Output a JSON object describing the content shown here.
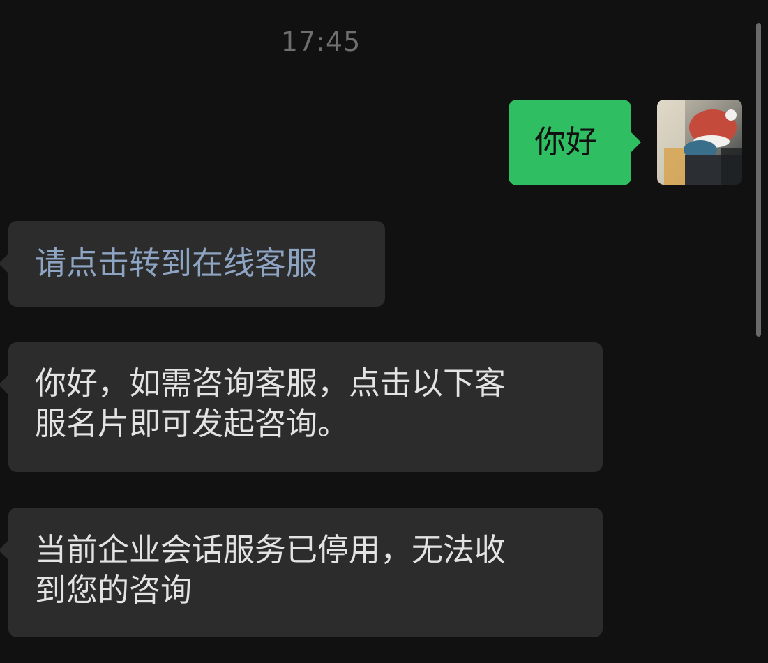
{
  "chat": {
    "timestamp": "17:45",
    "messages": [
      {
        "direction": "out",
        "text": "你好"
      },
      {
        "direction": "in",
        "text": "请点击转到在线客服",
        "style": "link"
      },
      {
        "direction": "in",
        "line1": "你好，如需咨询客服，点击以下客",
        "line2": "服名片即可发起咨询。"
      },
      {
        "direction": "in",
        "line1": "当前企业会话服务已停用，无法收",
        "line2": "到您的咨询"
      }
    ]
  },
  "colors": {
    "background": "#111111",
    "outgoing_bubble": "#2fbe62",
    "incoming_bubble": "#2c2c2c",
    "link_text": "#8ea4c3",
    "timestamp": "#6f6f6f"
  }
}
